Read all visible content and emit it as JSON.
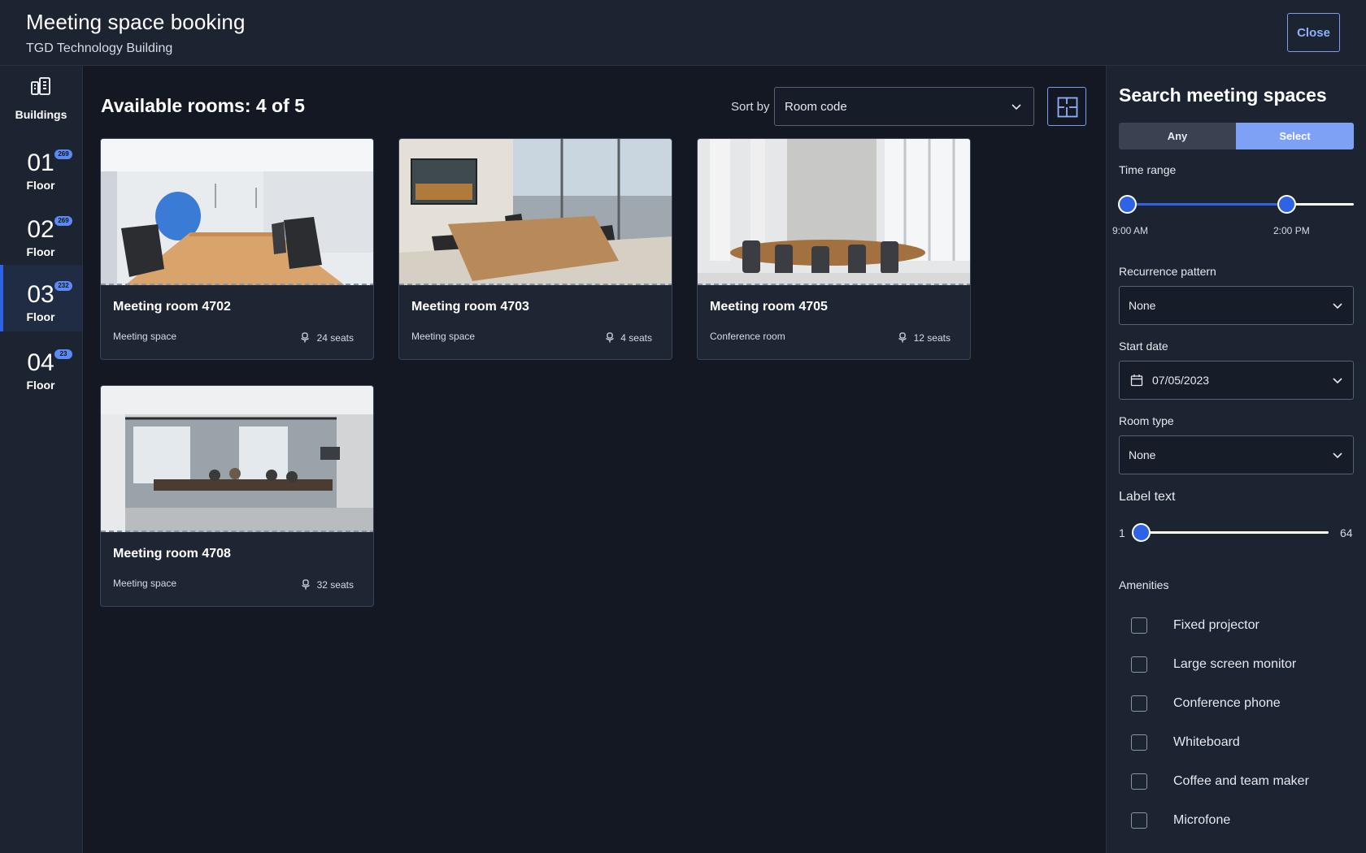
{
  "header": {
    "title": "Meeting space booking",
    "subtitle": "TGD Technology Building",
    "close_label": "Close"
  },
  "sidebar": {
    "buildings_label": "Buildings",
    "floors": [
      {
        "number": "01",
        "label": "Floor",
        "badge": "269",
        "active": false
      },
      {
        "number": "02",
        "label": "Floor",
        "badge": "269",
        "active": false
      },
      {
        "number": "03",
        "label": "Floor",
        "badge": "232",
        "active": true
      },
      {
        "number": "04",
        "label": "Floor",
        "badge": "23",
        "active": false
      }
    ]
  },
  "main": {
    "title": "Available rooms: 4 of 5",
    "sort_label": "Sort by",
    "sort_value": "Room code",
    "rooms": [
      {
        "name": "Meeting room 4702",
        "type": "Meeting space",
        "seats": "24 seats"
      },
      {
        "name": "Meeting room 4703",
        "type": "Meeting space",
        "seats": "4 seats"
      },
      {
        "name": "Meeting room 4705",
        "type": "Conference room",
        "seats": "12 seats"
      },
      {
        "name": "Meeting room 4708",
        "type": "Meeting space",
        "seats": "32 seats"
      }
    ]
  },
  "panel": {
    "title": "Search meeting spaces",
    "toggle": {
      "any": "Any",
      "select": "Select",
      "selected": "select"
    },
    "time_range": {
      "label": "Time range",
      "start": "9:00 AM",
      "end": "2:00 PM"
    },
    "recurrence": {
      "label": "Recurrence pattern",
      "value": "None"
    },
    "start_date": {
      "label": "Start date",
      "value": "07/05/2023"
    },
    "room_type": {
      "label": "Room type",
      "value": "None"
    },
    "label_text": {
      "label": "Label text",
      "min": "1",
      "max": "64",
      "value": 1
    },
    "amenities": {
      "label": "Amenities",
      "items": [
        "Fixed projector",
        "Large screen monitor",
        "Conference phone",
        "Whiteboard",
        "Coffee and team maker",
        "Microfone"
      ]
    }
  },
  "colors": {
    "accent": "#2f63e6",
    "accent_light": "#7fa1f5",
    "background": "#131823",
    "surface": "#1c2331"
  }
}
